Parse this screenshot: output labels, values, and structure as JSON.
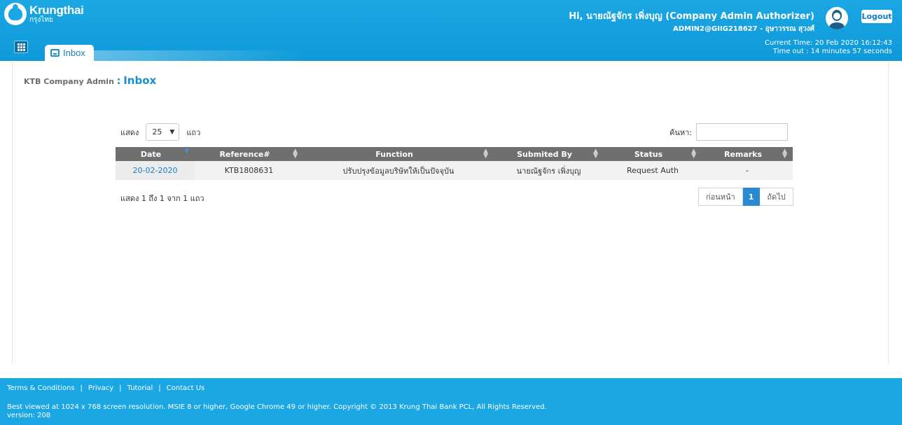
{
  "header": {
    "logo_en": "Krungthai",
    "logo_th": "กรุงไทย",
    "greeting": "Hi, นายณัฐจักร เพิ่งบุญ (Company Admin Authorizer)",
    "account": "ADMIN2@GIIG218627 - อุษาวรรณ สุวงศ์",
    "logout_label": "Logout",
    "current_time": "Current Time: 20 Feb 2020 16:12:43",
    "timeout": "Time out : 14 minutes 57 seconds",
    "tab_label": "Inbox",
    "accent_color": "#1ba7e3"
  },
  "breadcrumb": {
    "section": "KTB Company Admin",
    "separator": ":",
    "current": "Inbox"
  },
  "table_controls": {
    "show_label": "แสดง",
    "page_length": "25",
    "rows_label": "แถว",
    "search_label": "ค้นหา:",
    "search_value": ""
  },
  "table": {
    "columns": [
      "Date",
      "Reference#",
      "Function",
      "Submited By",
      "Status",
      "Remarks"
    ],
    "rows": [
      {
        "date": "20-02-2020",
        "reference": "KTB1808631",
        "function": "ปรับปรุงข้อมูลบริษัทให้เป็นปัจจุบัน",
        "submitted_by": "นายณัฐจักร เพิ่งบุญ",
        "status": "Request Auth",
        "remarks": "-"
      }
    ]
  },
  "pagination": {
    "info": "แสดง 1 ถึง 1 จาก 1 แถว",
    "prev_label": "ก่อนหน้า",
    "current_page": "1",
    "next_label": "ถัดไป"
  },
  "footer": {
    "links": [
      "Terms & Conditions",
      "Privacy",
      "Tutorial",
      "Contact Us"
    ],
    "separator": "|",
    "copyright": "Best viewed at 1024 x 768 screen resolution. MSIE 8 or higher, Google Chrome 49 or higher. Copyright © 2013 Krung Thai Bank PCL, All Rights Reserved.",
    "version": "version: 208"
  }
}
